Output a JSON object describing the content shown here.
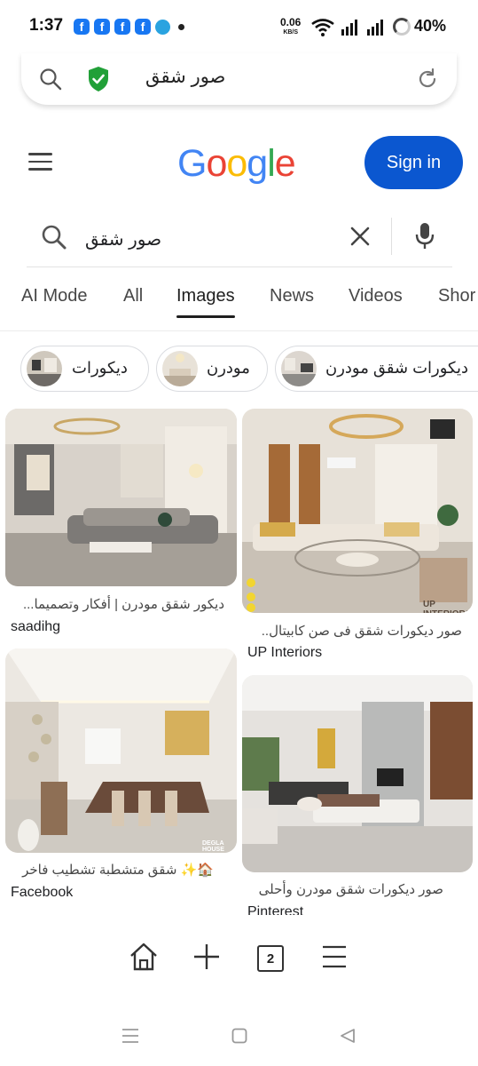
{
  "status_bar": {
    "time": "1:37",
    "notif_icons": [
      "facebook-icon",
      "facebook-icon",
      "facebook-icon",
      "facebook-icon",
      "telegram-icon"
    ],
    "net_speed": "0.06",
    "net_unit": "KB/S",
    "battery": "40%"
  },
  "address_bar": {
    "query": "صور شقق",
    "security": "secure-shield-icon"
  },
  "google_header": {
    "logo": "Google",
    "sign_in_label": "Sign in"
  },
  "search": {
    "query": "صور شقق"
  },
  "tabs": [
    {
      "label": "AI Mode"
    },
    {
      "label": "All"
    },
    {
      "label": "Images"
    },
    {
      "label": "News"
    },
    {
      "label": "Videos"
    },
    {
      "label": "Shor"
    }
  ],
  "active_tab": "Images",
  "chips": [
    {
      "label": "ديكورات"
    },
    {
      "label": "مودرن"
    },
    {
      "label": "ديكورات شقق مودرن"
    }
  ],
  "results": [
    {
      "caption": "ديكور شقق مودرن | أفكار وتصميما...",
      "source": "saadihg"
    },
    {
      "caption": "صور ديكورات شقق فى صن كابيتال..",
      "source": "UP Interiors",
      "watermark": "UP INTERIORS"
    },
    {
      "caption": "🏠✨ شقق متشطبة تشطيب فاخر",
      "source": "Facebook",
      "watermark": "DEGLA HOUSE"
    },
    {
      "caption": "صور ديكورات شقق مودرن وأحلى",
      "source": "Pinterest"
    }
  ],
  "browser_toolbar": {
    "tab_count": "2"
  },
  "colors": {
    "accent": "#0b57d0",
    "google_blue": "#4285f4",
    "google_red": "#ea4335",
    "google_yellow": "#fbbc05",
    "google_green": "#34a853"
  }
}
